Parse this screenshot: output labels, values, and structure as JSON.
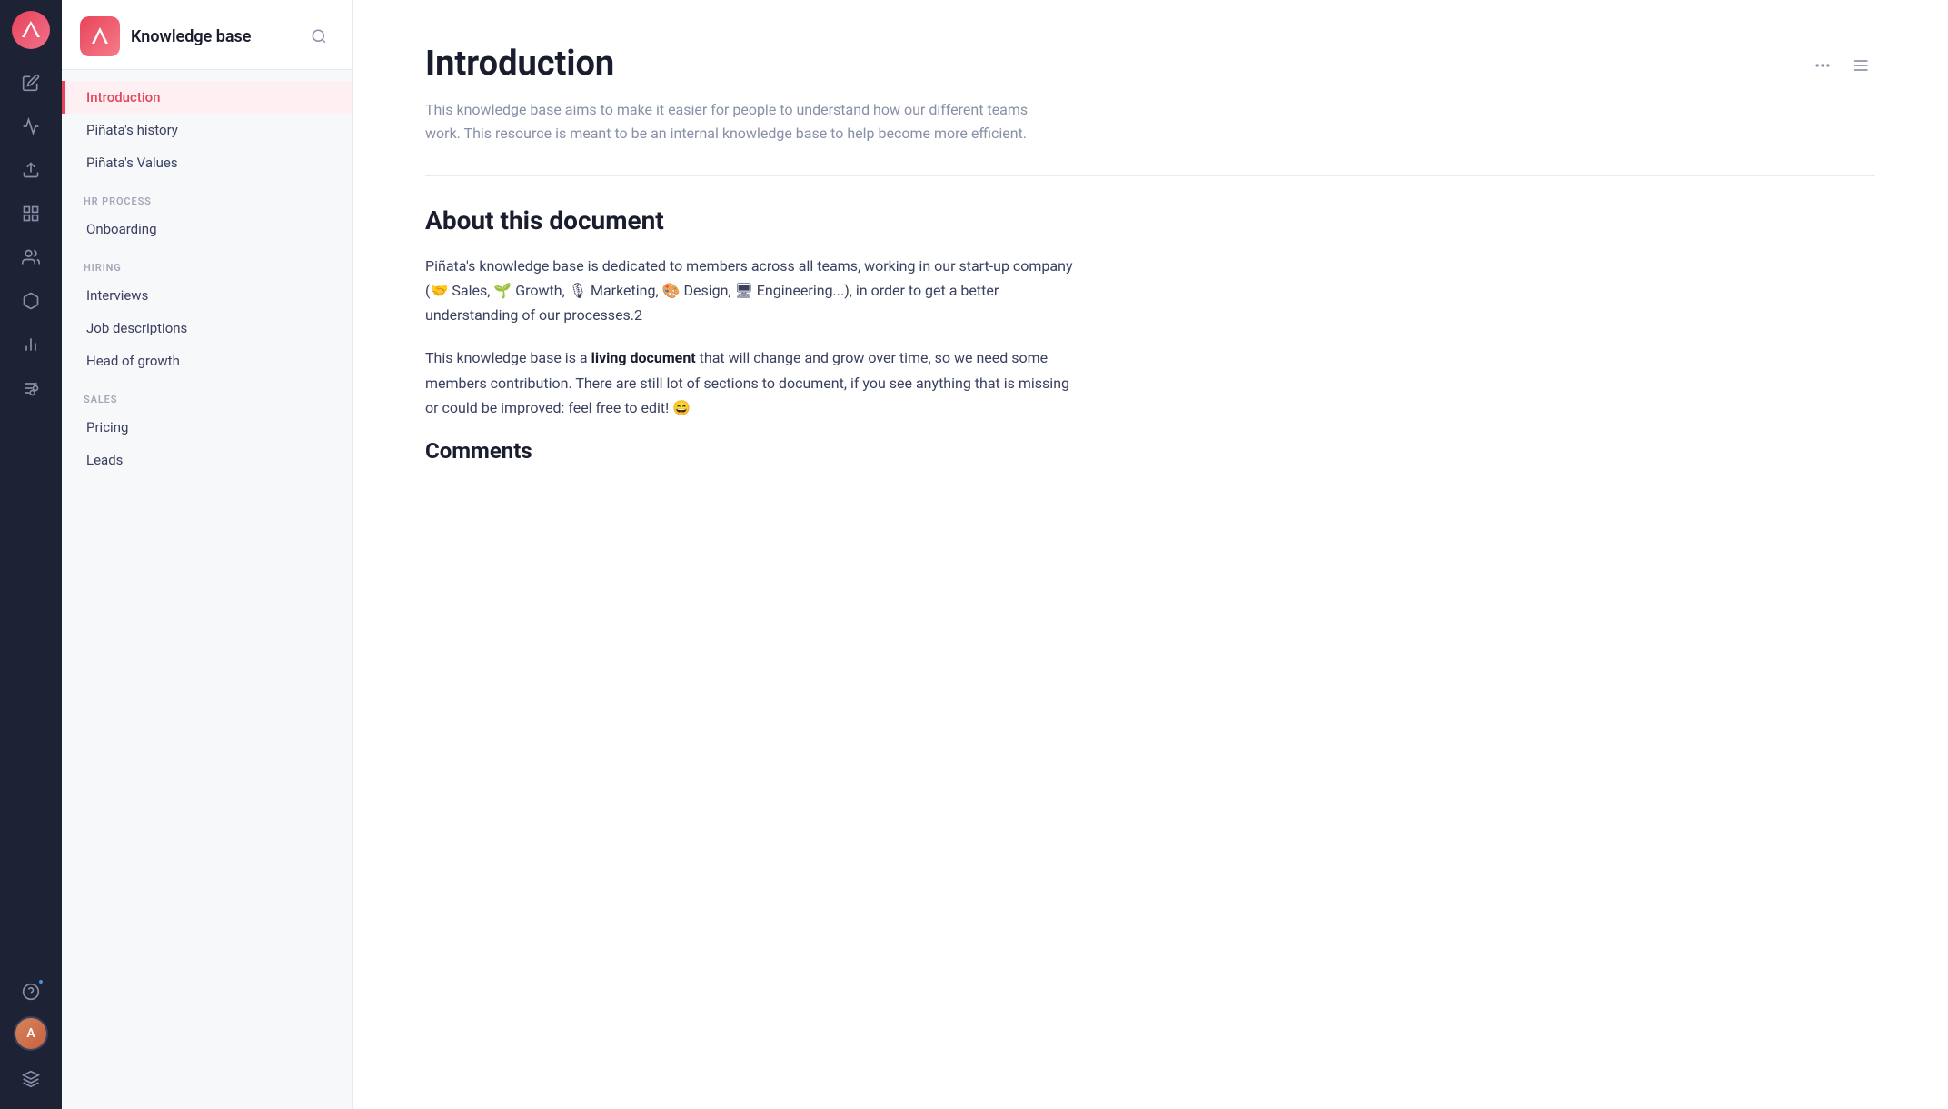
{
  "iconBar": {
    "logo": "▲",
    "items": [
      {
        "name": "edit-icon",
        "label": "Edit"
      },
      {
        "name": "analytics-icon",
        "label": "Analytics"
      },
      {
        "name": "share-icon",
        "label": "Share"
      },
      {
        "name": "brush-icon",
        "label": "Design"
      },
      {
        "name": "team-icon",
        "label": "Team"
      },
      {
        "name": "cube-icon",
        "label": "Cube"
      },
      {
        "name": "chart-icon",
        "label": "Chart"
      },
      {
        "name": "filter-icon",
        "label": "Filter"
      }
    ]
  },
  "sidebar": {
    "title": "Knowledge base",
    "navItems": [
      {
        "label": "Introduction",
        "active": true,
        "section": null
      },
      {
        "label": "Piñata's history",
        "active": false,
        "section": null
      },
      {
        "label": "Piñata's Values",
        "active": false,
        "section": null
      },
      {
        "label": "Onboarding",
        "active": false,
        "section": "HR PROCESS"
      },
      {
        "label": "Interviews",
        "active": false,
        "section": "HIRING"
      },
      {
        "label": "Job descriptions",
        "active": false,
        "section": null
      },
      {
        "label": "Head of growth",
        "active": false,
        "section": null
      },
      {
        "label": "Pricing",
        "active": false,
        "section": "SALES"
      },
      {
        "label": "Leads",
        "active": false,
        "section": null
      }
    ]
  },
  "main": {
    "title": "Introduction",
    "introText": "This knowledge base aims to make it easier for people to understand how our different teams work. This resource is meant to be an internal knowledge base to help become more efficient.",
    "sections": [
      {
        "id": "about",
        "title": "About this document",
        "paragraphs": [
          "Piñata's knowledge base is dedicated to members across all teams, working in our start-up company (🤝 Sales, 🌱 Growth, 🎙 Marketing, 🎨 Design, 🖥 Engineering...), in order to get a better understanding of our processes.2",
          "This knowledge base is a living document that will change and grow over time, so we need some members contribution. There are still lot of sections to document, if you see anything that is missing or could be improved: feel free to edit! 😄"
        ]
      },
      {
        "id": "comments",
        "title": "Comments"
      }
    ]
  },
  "colors": {
    "accent": "#e8445a",
    "textDark": "#1a1d2e",
    "textMid": "#3a4060",
    "textLight": "#8890a8",
    "bg": "#f7f8fa",
    "border": "#e8eaed"
  }
}
